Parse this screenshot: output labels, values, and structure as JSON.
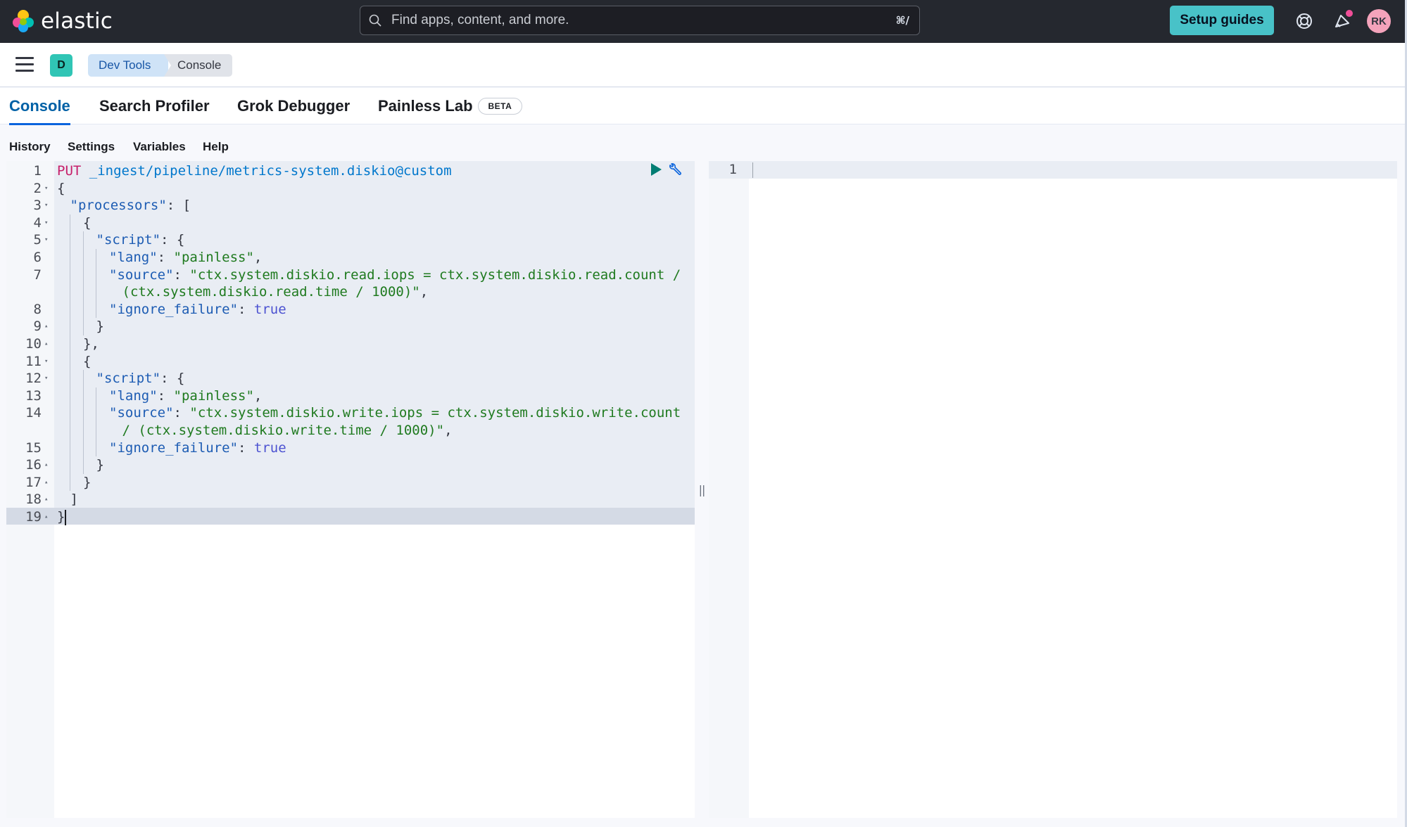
{
  "app": {
    "brand": "elastic",
    "search_placeholder": "Find apps, content, and more.",
    "search_shortcut": "⌘/",
    "setup_button": "Setup guides",
    "avatar_initials": "RK",
    "space_initial": "D"
  },
  "breadcrumbs": [
    "Dev Tools",
    "Console"
  ],
  "tabs": [
    {
      "label": "Console"
    },
    {
      "label": "Search Profiler"
    },
    {
      "label": "Grok Debugger"
    },
    {
      "label": "Painless Lab",
      "badge": "BETA"
    }
  ],
  "console_menu": [
    "History",
    "Settings",
    "Variables",
    "Help"
  ],
  "editor": {
    "method": "PUT",
    "url": "_ingest/pipeline/metrics-system.diskio@custom",
    "lines": [
      {
        "n": "1",
        "fold": ""
      },
      {
        "n": "2",
        "fold": "▾",
        "text": "{"
      },
      {
        "n": "3",
        "fold": "▾",
        "key": "\"processors\"",
        "rest": ": ["
      },
      {
        "n": "4",
        "fold": "▾",
        "text": "{"
      },
      {
        "n": "5",
        "fold": "▾",
        "key": "\"script\"",
        "rest": ": {"
      },
      {
        "n": "6",
        "fold": "",
        "key": "\"lang\"",
        "sep": ": ",
        "str": "\"painless\"",
        "tail": ","
      },
      {
        "n": "7",
        "fold": "",
        "key": "\"source\"",
        "sep": ": ",
        "str": "\"ctx.system.diskio.read.iops = ctx.system.diskio.read.count /",
        "tail": ""
      },
      {
        "n": "",
        "fold": "",
        "str": "(ctx.system.diskio.read.time / 1000)\"",
        "tail": ","
      },
      {
        "n": "8",
        "fold": "",
        "key": "\"ignore_failure\"",
        "sep": ": ",
        "bool": "true"
      },
      {
        "n": "9",
        "fold": "▴",
        "text": "}"
      },
      {
        "n": "10",
        "fold": "▴",
        "text": "},"
      },
      {
        "n": "11",
        "fold": "▾",
        "text": "{"
      },
      {
        "n": "12",
        "fold": "▾",
        "key": "\"script\"",
        "rest": ": {"
      },
      {
        "n": "13",
        "fold": "",
        "key": "\"lang\"",
        "sep": ": ",
        "str": "\"painless\"",
        "tail": ","
      },
      {
        "n": "14",
        "fold": "",
        "key": "\"source\"",
        "sep": ": ",
        "str": "\"ctx.system.diskio.write.iops = ctx.system.diskio.write.count",
        "tail": ""
      },
      {
        "n": "",
        "fold": "",
        "str": "/ (ctx.system.diskio.write.time / 1000)\"",
        "tail": ","
      },
      {
        "n": "15",
        "fold": "",
        "key": "\"ignore_failure\"",
        "sep": ": ",
        "bool": "true"
      },
      {
        "n": "16",
        "fold": "▴",
        "text": "}"
      },
      {
        "n": "17",
        "fold": "▴",
        "text": "}"
      },
      {
        "n": "18",
        "fold": "▴",
        "text": "]"
      },
      {
        "n": "19",
        "fold": "▴",
        "text": "}"
      }
    ]
  },
  "output": {
    "line_number": "1"
  },
  "colors": {
    "header_bg": "#25282f",
    "accent": "#0b64dd",
    "setup_button": "#48c2c8",
    "method": "#c61e69",
    "string": "#1f7a1f",
    "boolean": "#4c52d1"
  }
}
